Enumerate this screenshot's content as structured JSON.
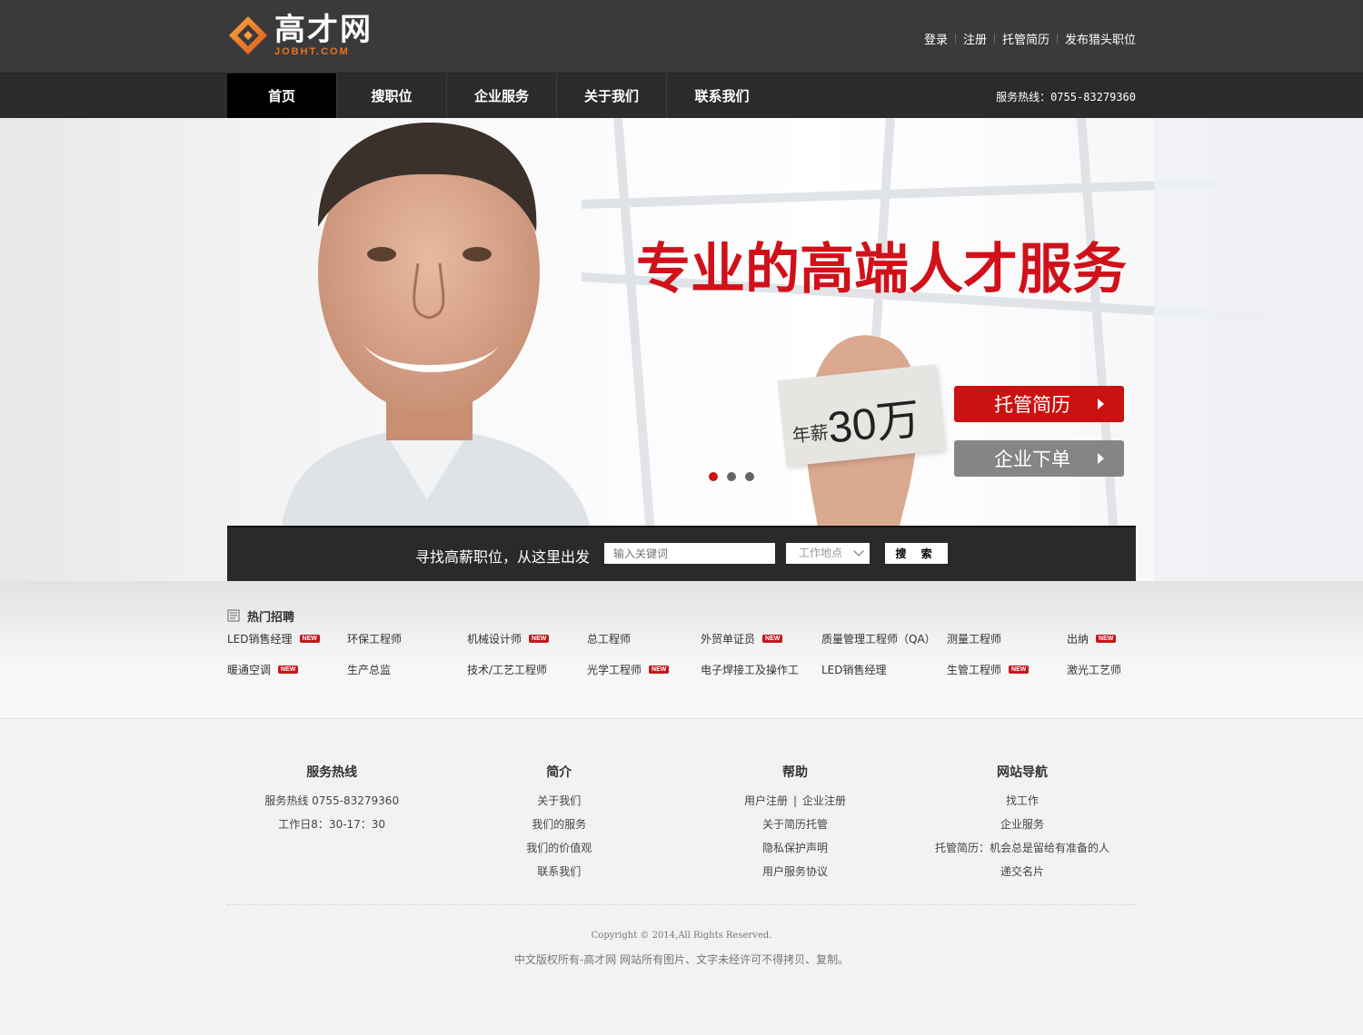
{
  "header": {
    "logo_cn": "高才网",
    "logo_en": "JOBHT.COM",
    "links": [
      "登录",
      "注册",
      "托管简历",
      "发布猎头职位"
    ]
  },
  "nav": {
    "items": [
      "首页",
      "搜职位",
      "企业服务",
      "关于我们",
      "联系我们"
    ],
    "active_index": 0,
    "hotline": "服务热线：0755-83279360"
  },
  "banner": {
    "headline": "专业的高端人才服务",
    "card_small": "年薪",
    "card_big": "30万",
    "cta_primary": "托管简历",
    "cta_secondary": "企业下单",
    "slide_count": 3,
    "active_slide": 0,
    "colors": {
      "accent": "#cc1111",
      "secondary": "#858585"
    }
  },
  "search": {
    "label": "寻找高薪职位，从这里出发",
    "keyword_placeholder": "输入关键词",
    "location_value": "工作地点",
    "button_label": "搜 索"
  },
  "hot_jobs": {
    "title": "热门招聘",
    "new_badge_text": "NEW",
    "rows": [
      [
        {
          "label": "LED销售经理",
          "new": true
        },
        {
          "label": "环保工程师",
          "new": false
        },
        {
          "label": "机械设计师",
          "new": true
        },
        {
          "label": "总工程师",
          "new": false
        },
        {
          "label": "外贸单证员",
          "new": true
        },
        {
          "label": "质量管理工程师（QA）",
          "new": false
        },
        {
          "label": "测量工程师",
          "new": false
        },
        {
          "label": "出纳",
          "new": true
        }
      ],
      [
        {
          "label": "暖通空调",
          "new": true
        },
        {
          "label": "生产总监",
          "new": false
        },
        {
          "label": "技术/工艺工程师",
          "new": false
        },
        {
          "label": "光学工程师",
          "new": true
        },
        {
          "label": "电子焊接工及操作工",
          "new": false
        },
        {
          "label": "LED销售经理",
          "new": false
        },
        {
          "label": "生管工程师",
          "new": true
        },
        {
          "label": "激光工艺师",
          "new": false
        }
      ]
    ]
  },
  "footer": {
    "columns": [
      {
        "title": "服务热线",
        "lines": [
          "服务热线 0755-83279360",
          "工作日8：30-17：30"
        ]
      },
      {
        "title": "简介",
        "lines": [
          "关于我们",
          "我们的服务",
          "我们的价值观",
          "联系我们"
        ]
      },
      {
        "title": "帮助",
        "lines": [
          "用户注册|企业注册",
          "关于简历托管",
          "隐私保护声明",
          "用户服务协议"
        ]
      },
      {
        "title": "网站导航",
        "lines": [
          "找工作",
          "企业服务",
          "托管简历：机会总是留给有准备的人",
          "递交名片"
        ]
      }
    ],
    "copyright": "Copyright © 2014,All Rights Reserved.",
    "notice": "中文版权所有-高才网 网站所有图片、文字未经许可不得拷贝、复制。"
  }
}
